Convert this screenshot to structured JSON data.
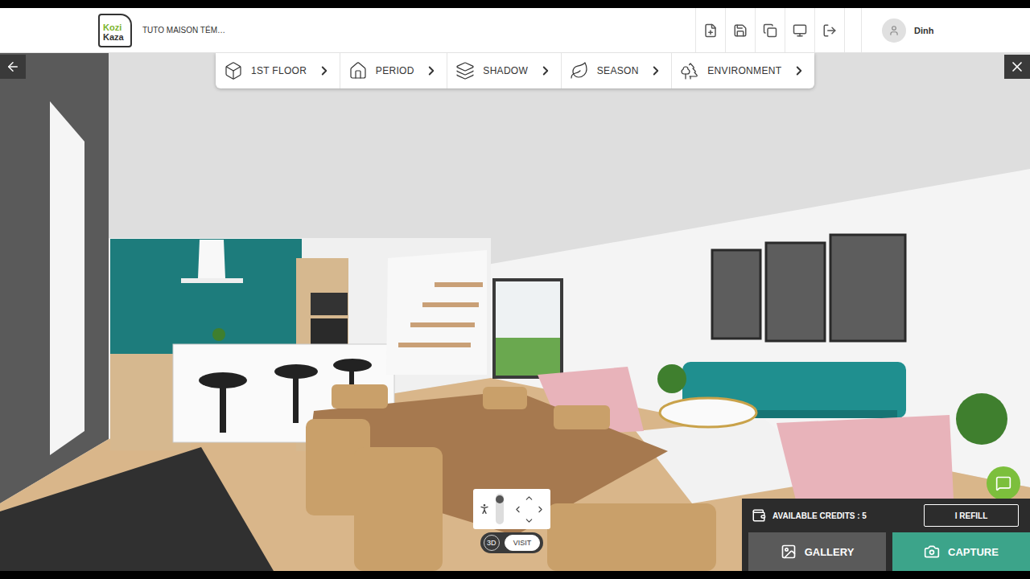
{
  "header": {
    "logo": {
      "top": "Kozi",
      "bottom": "Kaza"
    },
    "project_title": "TUTO MAISON TÉM…",
    "user": {
      "name": "Dinh"
    }
  },
  "toolbar": [
    {
      "label": "1ST FLOOR",
      "icon": "floor"
    },
    {
      "label": "PERIOD",
      "icon": "period"
    },
    {
      "label": "SHADOW",
      "icon": "shadow"
    },
    {
      "label": "SEASON",
      "icon": "season"
    },
    {
      "label": "ENVIRONMENT",
      "icon": "environment"
    }
  ],
  "view_modes": [
    {
      "label": "3D",
      "selected": false
    },
    {
      "label": "VISIT",
      "selected": true
    }
  ],
  "credits": {
    "label": "AVAILABLE CREDITS : 5",
    "refill": "I REFILL"
  },
  "actions": [
    {
      "label": "GALLERY",
      "kind": "secondary"
    },
    {
      "label": "CAPTURE",
      "kind": "primary"
    }
  ]
}
